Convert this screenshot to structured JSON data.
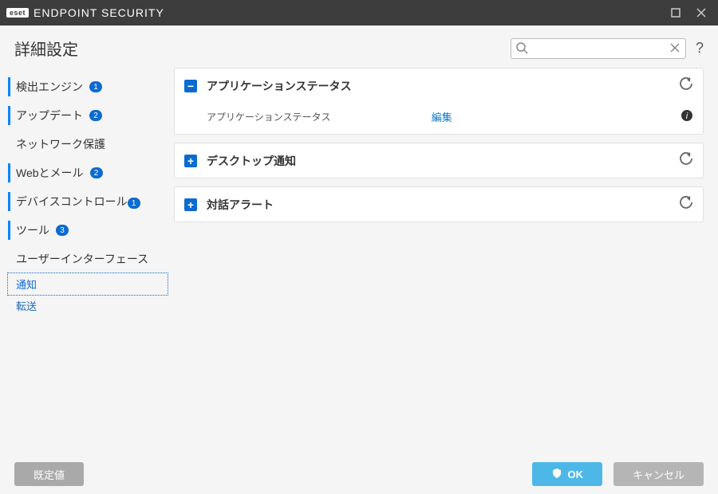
{
  "titlebar": {
    "brand_badge": "eset",
    "brand_text": "ENDPOINT SECURITY"
  },
  "header": {
    "title": "詳細設定",
    "help": "?"
  },
  "sidebar": {
    "items": [
      {
        "label": "検出エンジン",
        "badge": "1",
        "accent": true
      },
      {
        "label": "アップデート",
        "badge": "2",
        "accent": true
      },
      {
        "label": "ネットワーク保護",
        "badge": "",
        "accent": false
      },
      {
        "label": "Webとメール",
        "badge": "2",
        "accent": true
      },
      {
        "label": "デバイスコントロール",
        "badge": "1",
        "accent": true
      },
      {
        "label": "ツール",
        "badge": "3",
        "accent": true
      },
      {
        "label": "ユーザーインターフェース",
        "badge": "",
        "accent": false
      }
    ],
    "subs": [
      {
        "label": "通知",
        "selected": true
      },
      {
        "label": "転送",
        "selected": false
      }
    ]
  },
  "panels": [
    {
      "title": "アプリケーションステータス",
      "expanded": true,
      "row_label": "アプリケーションステータス",
      "edit": "編集"
    },
    {
      "title": "デスクトップ通知",
      "expanded": false
    },
    {
      "title": "対話アラート",
      "expanded": false
    }
  ],
  "footer": {
    "default": "既定値",
    "ok": "OK",
    "cancel": "キャンセル"
  }
}
